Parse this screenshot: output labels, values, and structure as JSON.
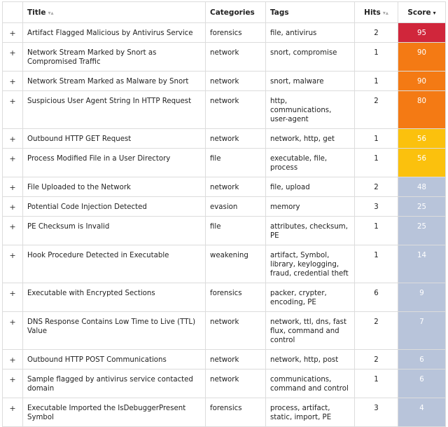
{
  "columns": {
    "title": "Title",
    "categories": "Categories",
    "tags": "Tags",
    "hits": "Hits",
    "score": "Score"
  },
  "sort_icons": {
    "title": "▾▴",
    "hits": "▾▴",
    "score": "▾"
  },
  "expand_symbol": "+",
  "rows": [
    {
      "title": "Artifact Flagged Malicious by Antivirus Service",
      "category": "forensics",
      "tags": "file, antivirus",
      "hits": "2",
      "score": "95",
      "color": "#d0263b"
    },
    {
      "title": "Network Stream Marked by Snort as Compromised Traffic",
      "category": "network",
      "tags": "snort, compromise",
      "hits": "1",
      "score": "90",
      "color": "#f47a14"
    },
    {
      "title": "Network Stream Marked as Malware by Snort",
      "category": "network",
      "tags": "snort, malware",
      "hits": "1",
      "score": "90",
      "color": "#f47a14"
    },
    {
      "title": "Suspicious User Agent String In HTTP Request",
      "category": "network",
      "tags": "http, communications, user-agent",
      "hits": "2",
      "score": "80",
      "color": "#f47a14"
    },
    {
      "title": "Outbound HTTP GET Request",
      "category": "network",
      "tags": "network, http, get",
      "hits": "1",
      "score": "56",
      "color": "#fbc10d"
    },
    {
      "title": "Process Modified File in a User Directory",
      "category": "file",
      "tags": "executable, file, process",
      "hits": "1",
      "score": "56",
      "color": "#fbc10d"
    },
    {
      "title": "File Uploaded to the Network",
      "category": "network",
      "tags": "file, upload",
      "hits": "2",
      "score": "48",
      "color": "#b8c4da"
    },
    {
      "title": "Potential Code Injection Detected",
      "category": "evasion",
      "tags": "memory",
      "hits": "3",
      "score": "25",
      "color": "#b8c4da"
    },
    {
      "title": "PE Checksum is Invalid",
      "category": "file",
      "tags": "attributes, checksum, PE",
      "hits": "1",
      "score": "25",
      "color": "#b8c4da"
    },
    {
      "title": "Hook Procedure Detected in Executable",
      "category": "weakening",
      "tags": "artifact, Symbol, library, keylogging, fraud, credential theft",
      "hits": "1",
      "score": "14",
      "color": "#b8c4da"
    },
    {
      "title": "Executable with Encrypted Sections",
      "category": "forensics",
      "tags": "packer, crypter, encoding, PE",
      "hits": "6",
      "score": "9",
      "color": "#b8c4da"
    },
    {
      "title": "DNS Response Contains Low Time to Live (TTL) Value",
      "category": "network",
      "tags": "network, ttl, dns, fast flux, command and control",
      "hits": "2",
      "score": "7",
      "color": "#b8c4da"
    },
    {
      "title": "Outbound HTTP POST Communications",
      "category": "network",
      "tags": "network, http, post",
      "hits": "2",
      "score": "6",
      "color": "#b8c4da"
    },
    {
      "title": "Sample flagged by antivirus service contacted domain",
      "category": "network",
      "tags": "communications, command and control",
      "hits": "1",
      "score": "6",
      "color": "#b8c4da"
    },
    {
      "title": "Executable Imported the IsDebuggerPresent Symbol",
      "category": "forensics",
      "tags": "process, artifact, static, import, PE",
      "hits": "3",
      "score": "4",
      "color": "#b8c4da"
    }
  ]
}
